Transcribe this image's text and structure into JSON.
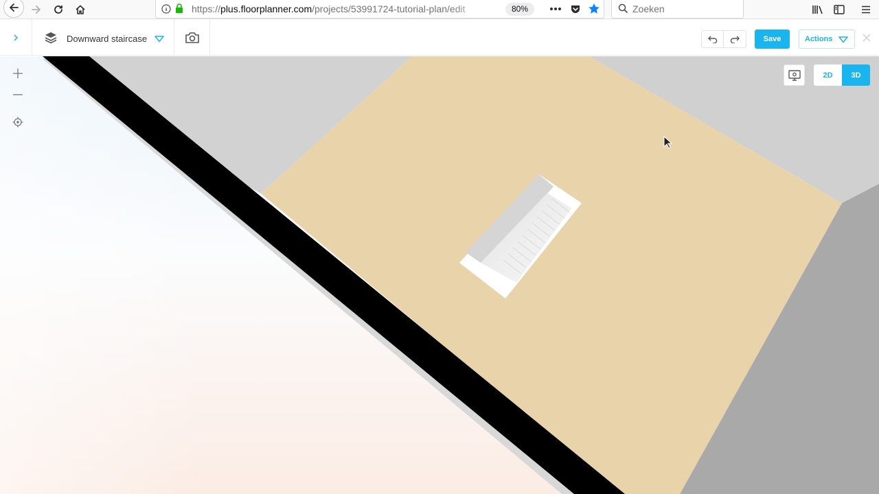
{
  "browser": {
    "url_scheme": "https://",
    "url_host": "plus.floorplanner.com",
    "url_path": "/projects/53991724-tutorial-plan/edit",
    "zoom": "80%",
    "search_placeholder": "Zoeken"
  },
  "toolbar": {
    "project_name": "Downward staircase",
    "save_label": "Save",
    "actions_label": "Actions"
  },
  "view": {
    "mode_2d": "2D",
    "mode_3d": "3D",
    "active_mode": "3D"
  },
  "colors": {
    "accent": "#1ab4ee",
    "floor": "#ebd2a8",
    "wall": "#000000"
  }
}
